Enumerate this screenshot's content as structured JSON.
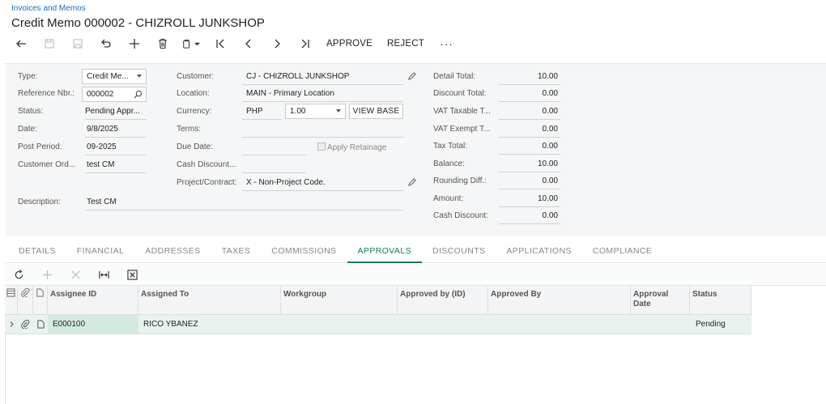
{
  "breadcrumb": "Invoices and Memos",
  "title": "Credit Memo 000002 - CHIZROLL JUNKSHOP",
  "toolbar": {
    "approve": "APPROVE",
    "reject": "REJECT",
    "more": "···"
  },
  "form": {
    "type_label": "Type:",
    "type_value": "Credit Me...",
    "ref_label": "Reference Nbr.:",
    "ref_value": "000002",
    "status_label": "Status:",
    "status_value": "Pending Appr...",
    "date_label": "Date:",
    "date_value": "9/8/2025",
    "post_label": "Post Period:",
    "post_value": "09-2025",
    "custord_label": "Customer Ord...",
    "custord_value": "test CM",
    "desc_label": "Description:",
    "desc_value": "Test CM",
    "customer_label": "Customer:",
    "customer_value": "CJ - CHIZROLL JUNKSHOP",
    "location_label": "Location:",
    "location_value": "MAIN - Primary Location",
    "currency_label": "Currency:",
    "currency_value": "PHP",
    "rate_value": "1.00",
    "view_base": "VIEW BASE",
    "terms_label": "Terms:",
    "due_label": "Due Date:",
    "retainage_label": "Apply Retainage",
    "cashdisc_label": "Cash Discount...",
    "project_label": "Project/Contract:",
    "project_value": "X - Non-Project Code.",
    "detail_total_label": "Detail Total:",
    "detail_total": "10.00",
    "discount_total_label": "Discount Total:",
    "discount_total": "0.00",
    "vat_taxable_label": "VAT Taxable T...",
    "vat_taxable": "0.00",
    "vat_exempt_label": "VAT Exempt T...",
    "vat_exempt": "0.00",
    "tax_total_label": "Tax Total:",
    "tax_total": "0.00",
    "balance_label": "Balance:",
    "balance": "10.00",
    "rounding_label": "Rounding Diff.:",
    "rounding": "0.00",
    "amount_label": "Amount:",
    "amount": "10.00",
    "cash_discount_label": "Cash Discount:",
    "cash_discount": "0.00"
  },
  "tabs": [
    "DETAILS",
    "FINANCIAL",
    "ADDRESSES",
    "TAXES",
    "COMMISSIONS",
    "APPROVALS",
    "DISCOUNTS",
    "APPLICATIONS",
    "COMPLIANCE"
  ],
  "grid": {
    "headers": [
      "Assignee ID",
      "Assigned To",
      "Workgroup",
      "Approved by (ID)",
      "Approved By",
      "Approval Date",
      "Status"
    ],
    "rows": [
      [
        "E000100",
        "RICO YBANEZ",
        "",
        "",
        "",
        "",
        "Pending"
      ]
    ]
  },
  "colors": {
    "accent": "#1a7a57",
    "link": "#1b6ec2",
    "row_selected": "#e8f3ee"
  }
}
